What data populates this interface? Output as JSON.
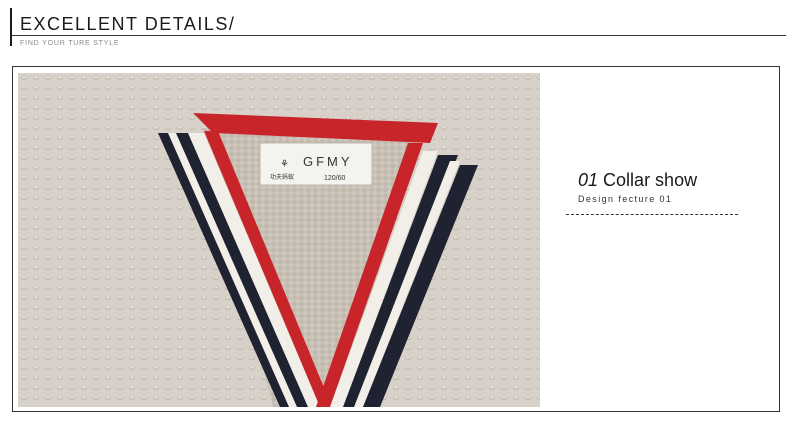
{
  "header": {
    "title": "EXCELLENT  DETAILS/",
    "subtitle": "FIND YOUR TURE STYLE"
  },
  "photo": {
    "label_brand": "GFMY",
    "label_size": "120/60",
    "label_chinese": "功夫蚂蚁",
    "colors": {
      "knit": "#d7d1c9",
      "inner_knit": "#cfc7bd",
      "stripe_red": "#c8252a",
      "stripe_navy": "#1f2230",
      "stripe_white": "#f2efe9"
    }
  },
  "caption": {
    "number": "01",
    "title": "Collar show",
    "subtitle": "Design fecture 01"
  }
}
